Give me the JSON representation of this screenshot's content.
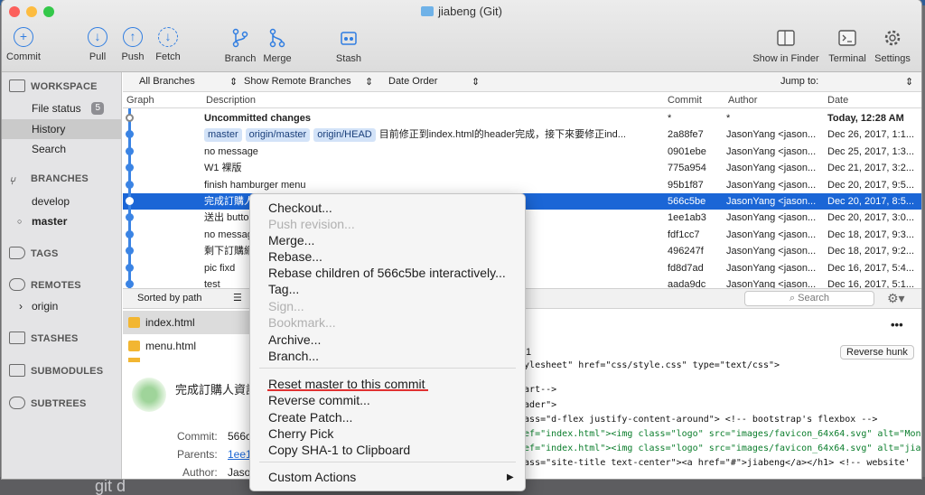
{
  "app": {
    "title": "jiabeng (Git)",
    "hidden_caption": "git d"
  },
  "colors": {
    "accent": "#2f7de1",
    "selection": "#1b66d6",
    "graph": "#3b84e4",
    "underline": "#e03030"
  },
  "toolbar": {
    "commit": "Commit",
    "pull": "Pull",
    "push": "Push",
    "fetch": "Fetch",
    "branch": "Branch",
    "merge": "Merge",
    "stash": "Stash",
    "show_in_finder": "Show in Finder",
    "terminal": "Terminal",
    "settings": "Settings"
  },
  "sidebar": {
    "workspace": "WORKSPACE",
    "file_status": "File status",
    "file_status_count": "5",
    "history": "History",
    "search": "Search",
    "branches": "BRANCHES",
    "develop": "develop",
    "master": "master",
    "tags": "TAGS",
    "remotes": "REMOTES",
    "origin": "origin",
    "stashes": "STASHES",
    "submodules": "SUBMODULES",
    "subtrees": "SUBTREES"
  },
  "options": {
    "all_branches": "All Branches",
    "show_remote": "Show Remote Branches",
    "date_order": "Date Order",
    "jump_to": "Jump to:"
  },
  "columns": {
    "graph": "Graph",
    "description": "Description",
    "commit": "Commit",
    "author": "Author",
    "date": "Date"
  },
  "rows": [
    {
      "desc": "Uncommitted changes",
      "commit": "*",
      "author": "*",
      "date": "Today, 12:28 AM"
    },
    {
      "tags": [
        "master",
        "origin/master",
        "origin/HEAD"
      ],
      "desc": "目前修正到index.html的header完成，接下來要修正ind...",
      "commit": "2a88fe7",
      "author": "JasonYang <jason...",
      "date": "Dec 26, 2017, 1:1..."
    },
    {
      "desc": "no message",
      "commit": "0901ebe",
      "author": "JasonYang <jason...",
      "date": "Dec 25, 2017, 1:3..."
    },
    {
      "desc": "W1 裸版",
      "commit": "775a954",
      "author": "JasonYang <jason...",
      "date": "Dec 21, 2017, 3:2..."
    },
    {
      "desc": "finish hamburger menu",
      "commit": "95b1f87",
      "author": "JasonYang <jason...",
      "date": "Dec 20, 2017, 9:5..."
    },
    {
      "desc": "完成訂購人",
      "commit": "566c5be",
      "author": "JasonYang <jason...",
      "date": "Dec 20, 2017, 8:5..."
    },
    {
      "desc": "送出 butto",
      "commit": "1ee1ab3",
      "author": "JasonYang <jason...",
      "date": "Dec 20, 2017, 3:0..."
    },
    {
      "desc": "no messag",
      "commit": "fdf1cc7",
      "author": "JasonYang <jason...",
      "date": "Dec 18, 2017, 9:3..."
    },
    {
      "desc": "剩下訂購網",
      "commit": "496247f",
      "author": "JasonYang <jason...",
      "date": "Dec 18, 2017, 9:2..."
    },
    {
      "desc": "pic fixd",
      "commit": "fd8d7ad",
      "author": "JasonYang <jason...",
      "date": "Dec 16, 2017, 5:4..."
    },
    {
      "desc": "test",
      "commit": "aada9dc",
      "author": "JasonYang <jason...",
      "date": "Dec 16, 2017, 5:1..."
    }
  ],
  "lower": {
    "sort": "Sorted by path",
    "search_placeholder": "Search",
    "more": "•••",
    "reverse_hunk": "Reverse hunk",
    "hunk_fragment": "1",
    "files": [
      "index.html",
      "menu.html"
    ],
    "commit_title": "完成訂購人資訊",
    "commit_label": "Commit:",
    "commit_val": "566c",
    "parents_label": "Parents:",
    "parents_val": "1ee1",
    "author_label": "Author:",
    "author_val": "Jaso",
    "code": [
      "stylesheet\" href=\"css/style.css\" type=\"text/css\">",
      "",
      "start-->",
      "header\">",
      "class=\"d-flex justify-content-around\">  <!-- bootstrap's flexbox -->",
      "href=\"index.html\"><img class=\"logo\" src=\"images/favicon_64x64.svg\" alt=\"Mon",
      "href=\"index.html\"><img class=\"logo\" src=\"images/favicon_64x64.svg\" alt=\"jia",
      "class=\"site-title text-center\"><a href=\"#\">jiabeng</a></h1>  <!-- website'"
    ]
  },
  "menu": {
    "items": [
      "Checkout...",
      "Push revision...",
      "Merge...",
      "Rebase...",
      "Rebase children of 566c5be interactively...",
      "Tag...",
      "Sign...",
      "Bookmark...",
      "Archive...",
      "Branch...",
      "Reset master to this commit",
      "Reverse commit...",
      "Create Patch...",
      "Cherry Pick",
      "Copy SHA-1 to Clipboard",
      "Custom Actions"
    ],
    "arrow": "▶"
  }
}
